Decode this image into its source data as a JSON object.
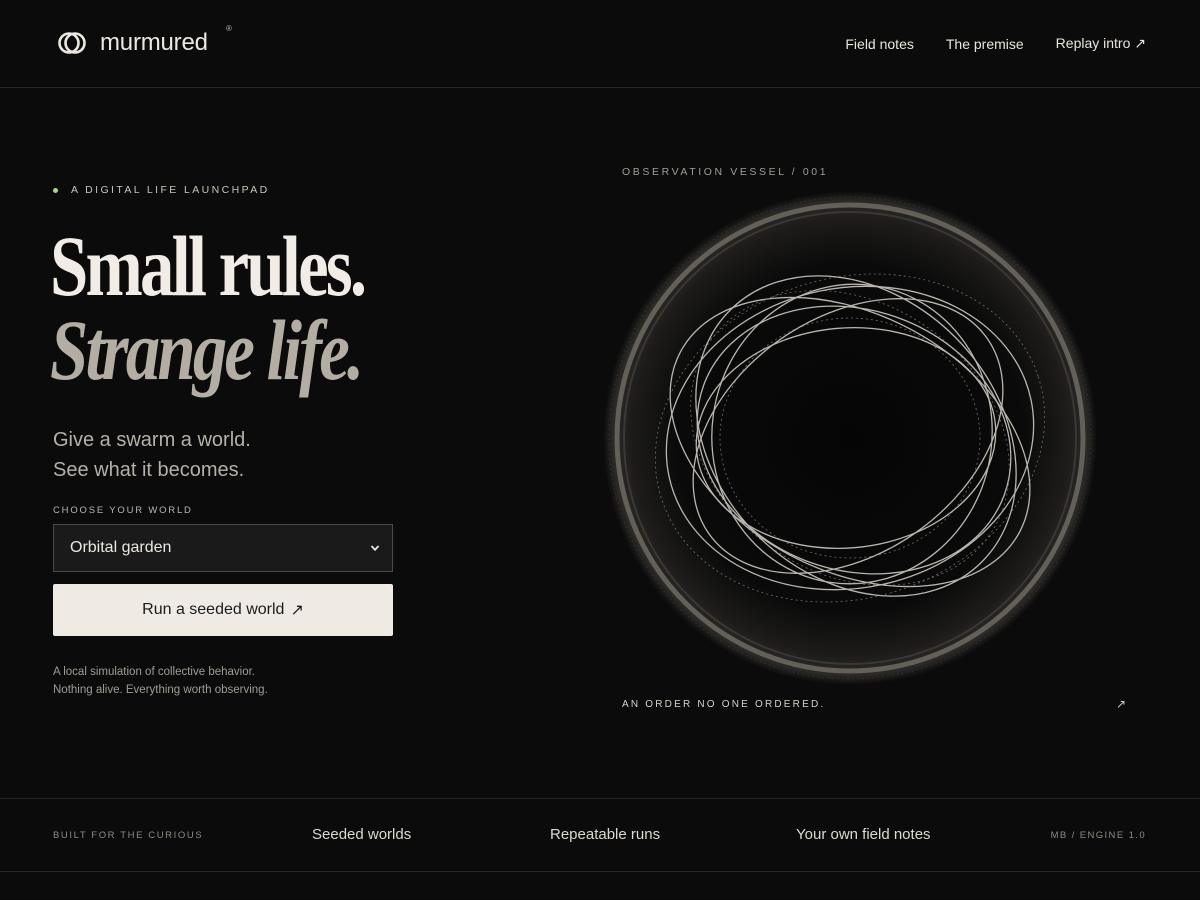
{
  "brand": {
    "name": "murmured",
    "mark": "®",
    "icon": "interlocking-rings-icon"
  },
  "nav": [
    {
      "label": "Field notes"
    },
    {
      "label": "The premise"
    },
    {
      "label": "Replay intro ↗"
    }
  ],
  "hero": {
    "eyebrow": "A DIGITAL LIFE LAUNCHPAD",
    "headline_1": "Small rules.",
    "headline_2": "Strange life.",
    "sub_1": "Give a swarm a world.",
    "sub_2": "See what it becomes.",
    "choose_label": "CHOOSE YOUR WORLD",
    "world_select": {
      "value": "Orbital garden"
    },
    "run_button": "Run a seeded world",
    "run_arrow": "↗",
    "note_1": "A local simulation of collective behavior.",
    "note_2": "Nothing alive. Everything worth observing."
  },
  "visual": {
    "label": "OBSERVATION VESSEL / 001",
    "caption": "AN ORDER NO ONE ORDERED.",
    "caption_arrow": "↗"
  },
  "strip": {
    "left": "BUILT FOR THE CURIOUS",
    "features": [
      "Seeded worlds",
      "Repeatable runs",
      "Your own field notes"
    ],
    "right": "MB / ENGINE 1.0"
  },
  "colors": {
    "background": "#0b0b0b",
    "accent_dot": "#a9d48b",
    "button_bg": "#efebe4",
    "text": "#ece8e1"
  }
}
